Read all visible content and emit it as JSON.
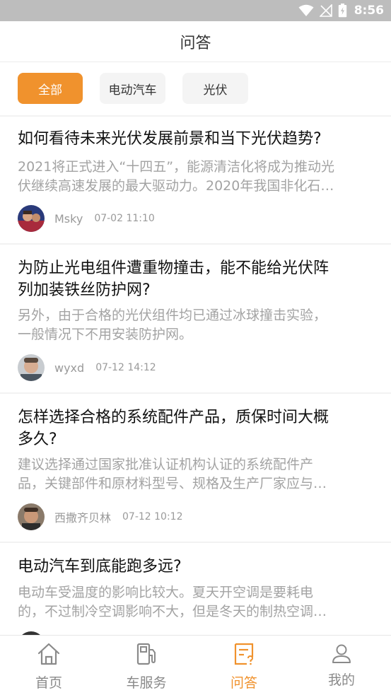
{
  "status_bar": {
    "time": "8:56",
    "icons": [
      "wifi-icon",
      "signal-icon",
      "battery-icon"
    ]
  },
  "header": {
    "title": "问答"
  },
  "filters": [
    {
      "label": "全部",
      "active": true
    },
    {
      "label": "电动汽车",
      "active": false
    },
    {
      "label": "光伏",
      "active": false
    }
  ],
  "questions": [
    {
      "title": "如何看待未来光伏发展前景和当下光伏趋势?",
      "desc_line1": "2021将正式进入“十四五”，能源清洁化将成为推动光",
      "desc_line2": "伏继续高速发展的最大驱动力。2020年我国非化石…",
      "author": "Msky",
      "time": "07-02 11:10"
    },
    {
      "title_line1": "为防止光电组件遭重物撞击，能不能给光伏阵",
      "title_line2": "列加装铁丝防护网?",
      "desc_line1": "另外，由于合格的光伏组件均已通过冰球撞击实验，",
      "desc_line2": "一般情况下不用安装防护网。",
      "author": "wyxd",
      "time": "07-12 14:12"
    },
    {
      "title_line1": "怎样选择合格的系统配件产品，质保时间大概",
      "title_line2": "多久?",
      "desc_line1": "建议选择通过国家批准认证机构认证的系统配件产",
      "desc_line2": "品，关键部件和原材料型号、规格及生产厂家应与…",
      "author": "西撒齐贝林",
      "time": "07-12 10:12"
    },
    {
      "title": "电动汽车到底能跑多远?",
      "desc_line1": "电动车受温度的影响比较大。夏天开空调是要耗电",
      "desc_line2": "的，不过制冷空调影响不大，但是冬天的制热空调…"
    }
  ],
  "tabbar": [
    {
      "label": "首页",
      "icon": "home-icon",
      "active": false
    },
    {
      "label": "车服务",
      "icon": "fuel-pump-icon",
      "active": false
    },
    {
      "label": "问答",
      "icon": "qa-document-icon",
      "active": true
    },
    {
      "label": "我的",
      "icon": "user-icon",
      "active": false
    }
  ],
  "colors": {
    "accent": "#f0922d",
    "status_bar": "#bdbdbd",
    "separator": "#f2f2f2"
  }
}
